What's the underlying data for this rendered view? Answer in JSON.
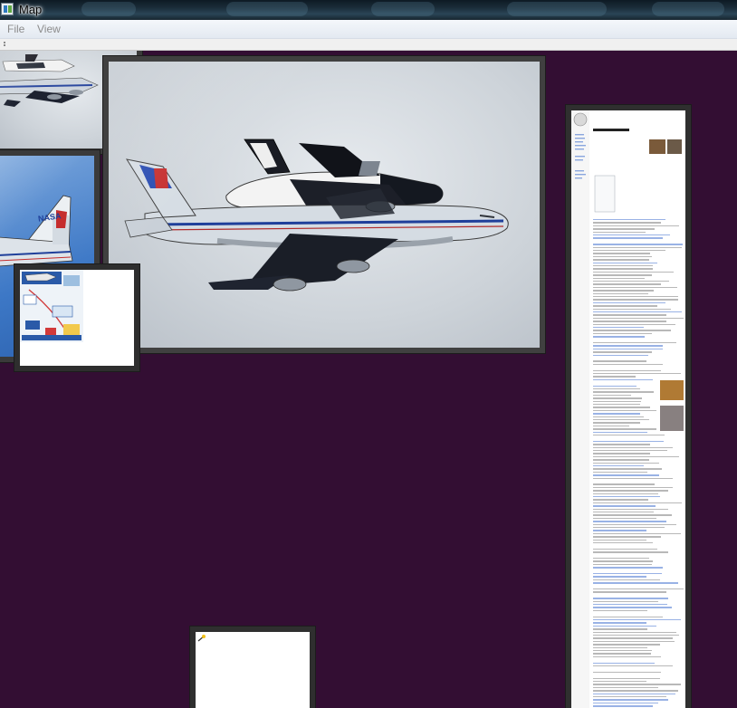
{
  "window": {
    "title": "Map",
    "icon": "app-icon"
  },
  "menu": {
    "items": [
      {
        "label": "File"
      },
      {
        "label": "View"
      }
    ]
  },
  "canvas": {
    "background": "#330e33",
    "tiles": [
      {
        "name": "shuttle-carrier-photo-top-left",
        "kind": "photo"
      },
      {
        "name": "shuttle-carrier-photo-main",
        "kind": "photo"
      },
      {
        "name": "nasa-tail-photo",
        "kind": "photo"
      },
      {
        "name": "infographic-thumbnail",
        "kind": "image"
      },
      {
        "name": "wikipedia-article-page",
        "kind": "document"
      },
      {
        "name": "blank-document-page",
        "kind": "document"
      }
    ]
  },
  "photo_text": {
    "tail_logo": "NASA"
  },
  "colors": {
    "titlebar": "#1b2d3a",
    "menubar": "#e3e9f1",
    "menu_text_disabled": "#8c8c8c",
    "frame": "#3a3a3a",
    "wiki_link": "#3366cc"
  }
}
